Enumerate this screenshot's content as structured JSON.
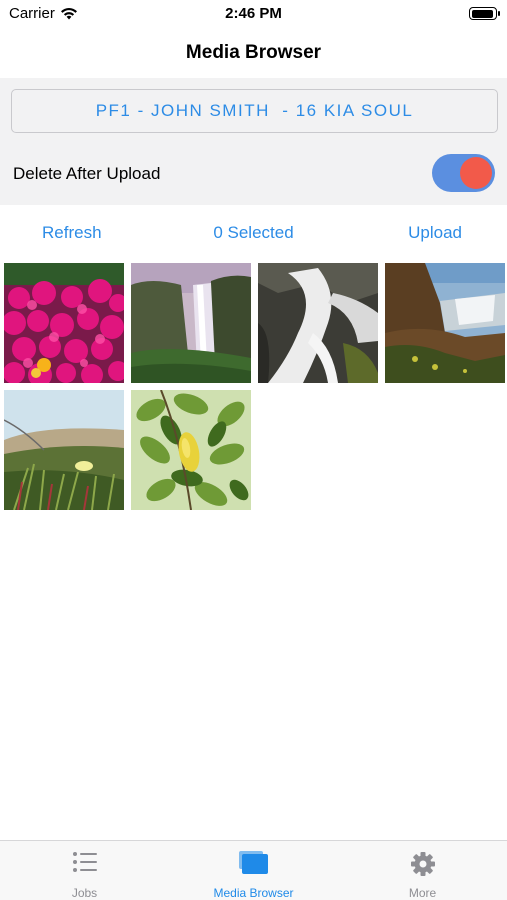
{
  "status_bar": {
    "carrier": "Carrier",
    "time": "2:46 PM"
  },
  "nav": {
    "title": "Media Browser"
  },
  "job": {
    "label": "PF1 - JOHN SMITH  - 16 KIA SOUL"
  },
  "settings": {
    "delete_after_upload_label": "Delete After Upload",
    "delete_after_upload": true
  },
  "actions": {
    "refresh": "Refresh",
    "selected": "0 Selected",
    "upload": "Upload"
  },
  "photos": [
    {
      "subject": "pink flowers"
    },
    {
      "subject": "waterfall"
    },
    {
      "subject": "rapids"
    },
    {
      "subject": "falls landscape"
    },
    {
      "subject": "beach dunes"
    },
    {
      "subject": "lemon tree"
    }
  ],
  "tabs": [
    {
      "label": "Jobs",
      "icon": "list-icon",
      "active": false
    },
    {
      "label": "Media Browser",
      "icon": "media-stack-icon",
      "active": true
    },
    {
      "label": "More",
      "icon": "gear-icon",
      "active": false
    }
  ],
  "colors": {
    "accent": "#2d8ce6",
    "toggle_track": "#5b8fe0",
    "toggle_knob": "#f25a4a",
    "panel_bg": "#f2f2f3"
  }
}
